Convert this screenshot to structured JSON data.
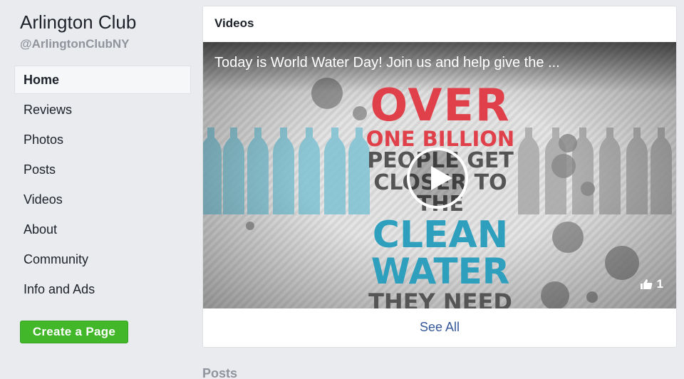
{
  "page": {
    "name": "Arlington Club",
    "handle": "@ArlingtonClubNY"
  },
  "nav": {
    "items": [
      {
        "label": "Home",
        "active": true
      },
      {
        "label": "Reviews"
      },
      {
        "label": "Photos"
      },
      {
        "label": "Posts"
      },
      {
        "label": "Videos"
      },
      {
        "label": "About"
      },
      {
        "label": "Community"
      },
      {
        "label": "Info and Ads"
      }
    ]
  },
  "create_page_label": "Create a Page",
  "videos": {
    "heading": "Videos",
    "video_title": "Today is World Water Day! Join us and help give the ...",
    "poster": {
      "line1": "OVER",
      "line2": "ONE BILLION",
      "line3": "PEOPLE GET",
      "line4": "CLOSER TO THE",
      "line5": "CLEAN",
      "line6": "WATER",
      "line7": "THEY NEED"
    },
    "like_count": "1",
    "see_all_label": "See All"
  },
  "posts_heading": "Posts",
  "colors": {
    "link": "#365899",
    "create_button": "#42b72a",
    "poster_red": "#e0404a",
    "poster_blue": "#2ea0bd"
  }
}
